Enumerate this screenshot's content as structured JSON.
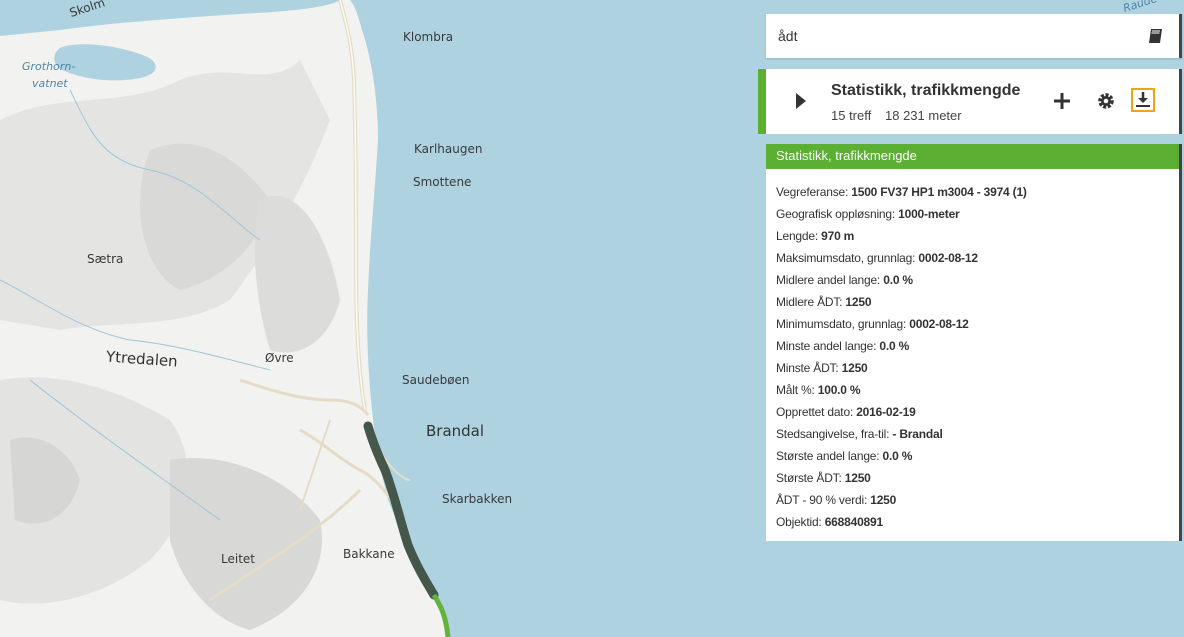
{
  "map": {
    "colors": {
      "water": "#aed2e0",
      "land": "#f2f2f0",
      "road": "#e4dcc6",
      "route_dark": "#45564a",
      "route_green": "#64b23e"
    },
    "places": [
      {
        "id": "skolm",
        "label": "Skolm"
      },
      {
        "id": "grothorn",
        "label": "Grothorn-"
      },
      {
        "id": "vatnet",
        "label": "vatnet"
      },
      {
        "id": "klombra",
        "label": "Klombra"
      },
      {
        "id": "karlhaugen",
        "label": "Karlhaugen"
      },
      {
        "id": "smottene",
        "label": "Smottene"
      },
      {
        "id": "saetra",
        "label": "Sætra"
      },
      {
        "id": "ytredalen",
        "label": "Ytredalen"
      },
      {
        "id": "ovre",
        "label": "Øvre"
      },
      {
        "id": "saudeboen",
        "label": "Saudebøen"
      },
      {
        "id": "brandal",
        "label": "Brandal"
      },
      {
        "id": "skarbakken",
        "label": "Skarbakken"
      },
      {
        "id": "leitet",
        "label": "Leitet"
      },
      {
        "id": "bakkane",
        "label": "Bakkane"
      },
      {
        "id": "raude",
        "label": "Raude"
      }
    ]
  },
  "search": {
    "value": "ådt",
    "icon": "book-icon"
  },
  "result": {
    "title": "Statistikk, trafikkmengde",
    "count": "15 treff",
    "length": "18 231 meter",
    "buttons": {
      "expand": "play-icon",
      "add": "plus-icon",
      "settings": "gear-icon",
      "download": "download-icon"
    }
  },
  "info": {
    "title": "Statistikk, trafikkmengde",
    "rows": [
      {
        "label": "Vegreferanse: ",
        "value": "1500 FV37 HP1 m3004 - 3974 (1)"
      },
      {
        "label": "Geografisk oppløsning: ",
        "value": "1000-meter"
      },
      {
        "label": "Lengde: ",
        "value": "970 m"
      },
      {
        "label": "Maksimumsdato, grunnlag: ",
        "value": "0002-08-12"
      },
      {
        "label": "Midlere andel lange: ",
        "value": "0.0 %"
      },
      {
        "label": "Midlere ÅDT: ",
        "value": "1250"
      },
      {
        "label": "Minimumsdato, grunnlag: ",
        "value": "0002-08-12"
      },
      {
        "label": "Minste andel lange: ",
        "value": "0.0 %"
      },
      {
        "label": "Minste ÅDT: ",
        "value": "1250"
      },
      {
        "label": "Målt %: ",
        "value": "100.0 %"
      },
      {
        "label": "Opprettet dato: ",
        "value": "2016-02-19"
      },
      {
        "label": "Stedsangivelse, fra-til: ",
        "value": "- Brandal"
      },
      {
        "label": "Største andel lange: ",
        "value": "0.0 %"
      },
      {
        "label": "Største ÅDT: ",
        "value": "1250"
      },
      {
        "label": "ÅDT - 90 % verdi: ",
        "value": "1250"
      },
      {
        "label": "Objektid: ",
        "value": "668840891"
      }
    ]
  }
}
